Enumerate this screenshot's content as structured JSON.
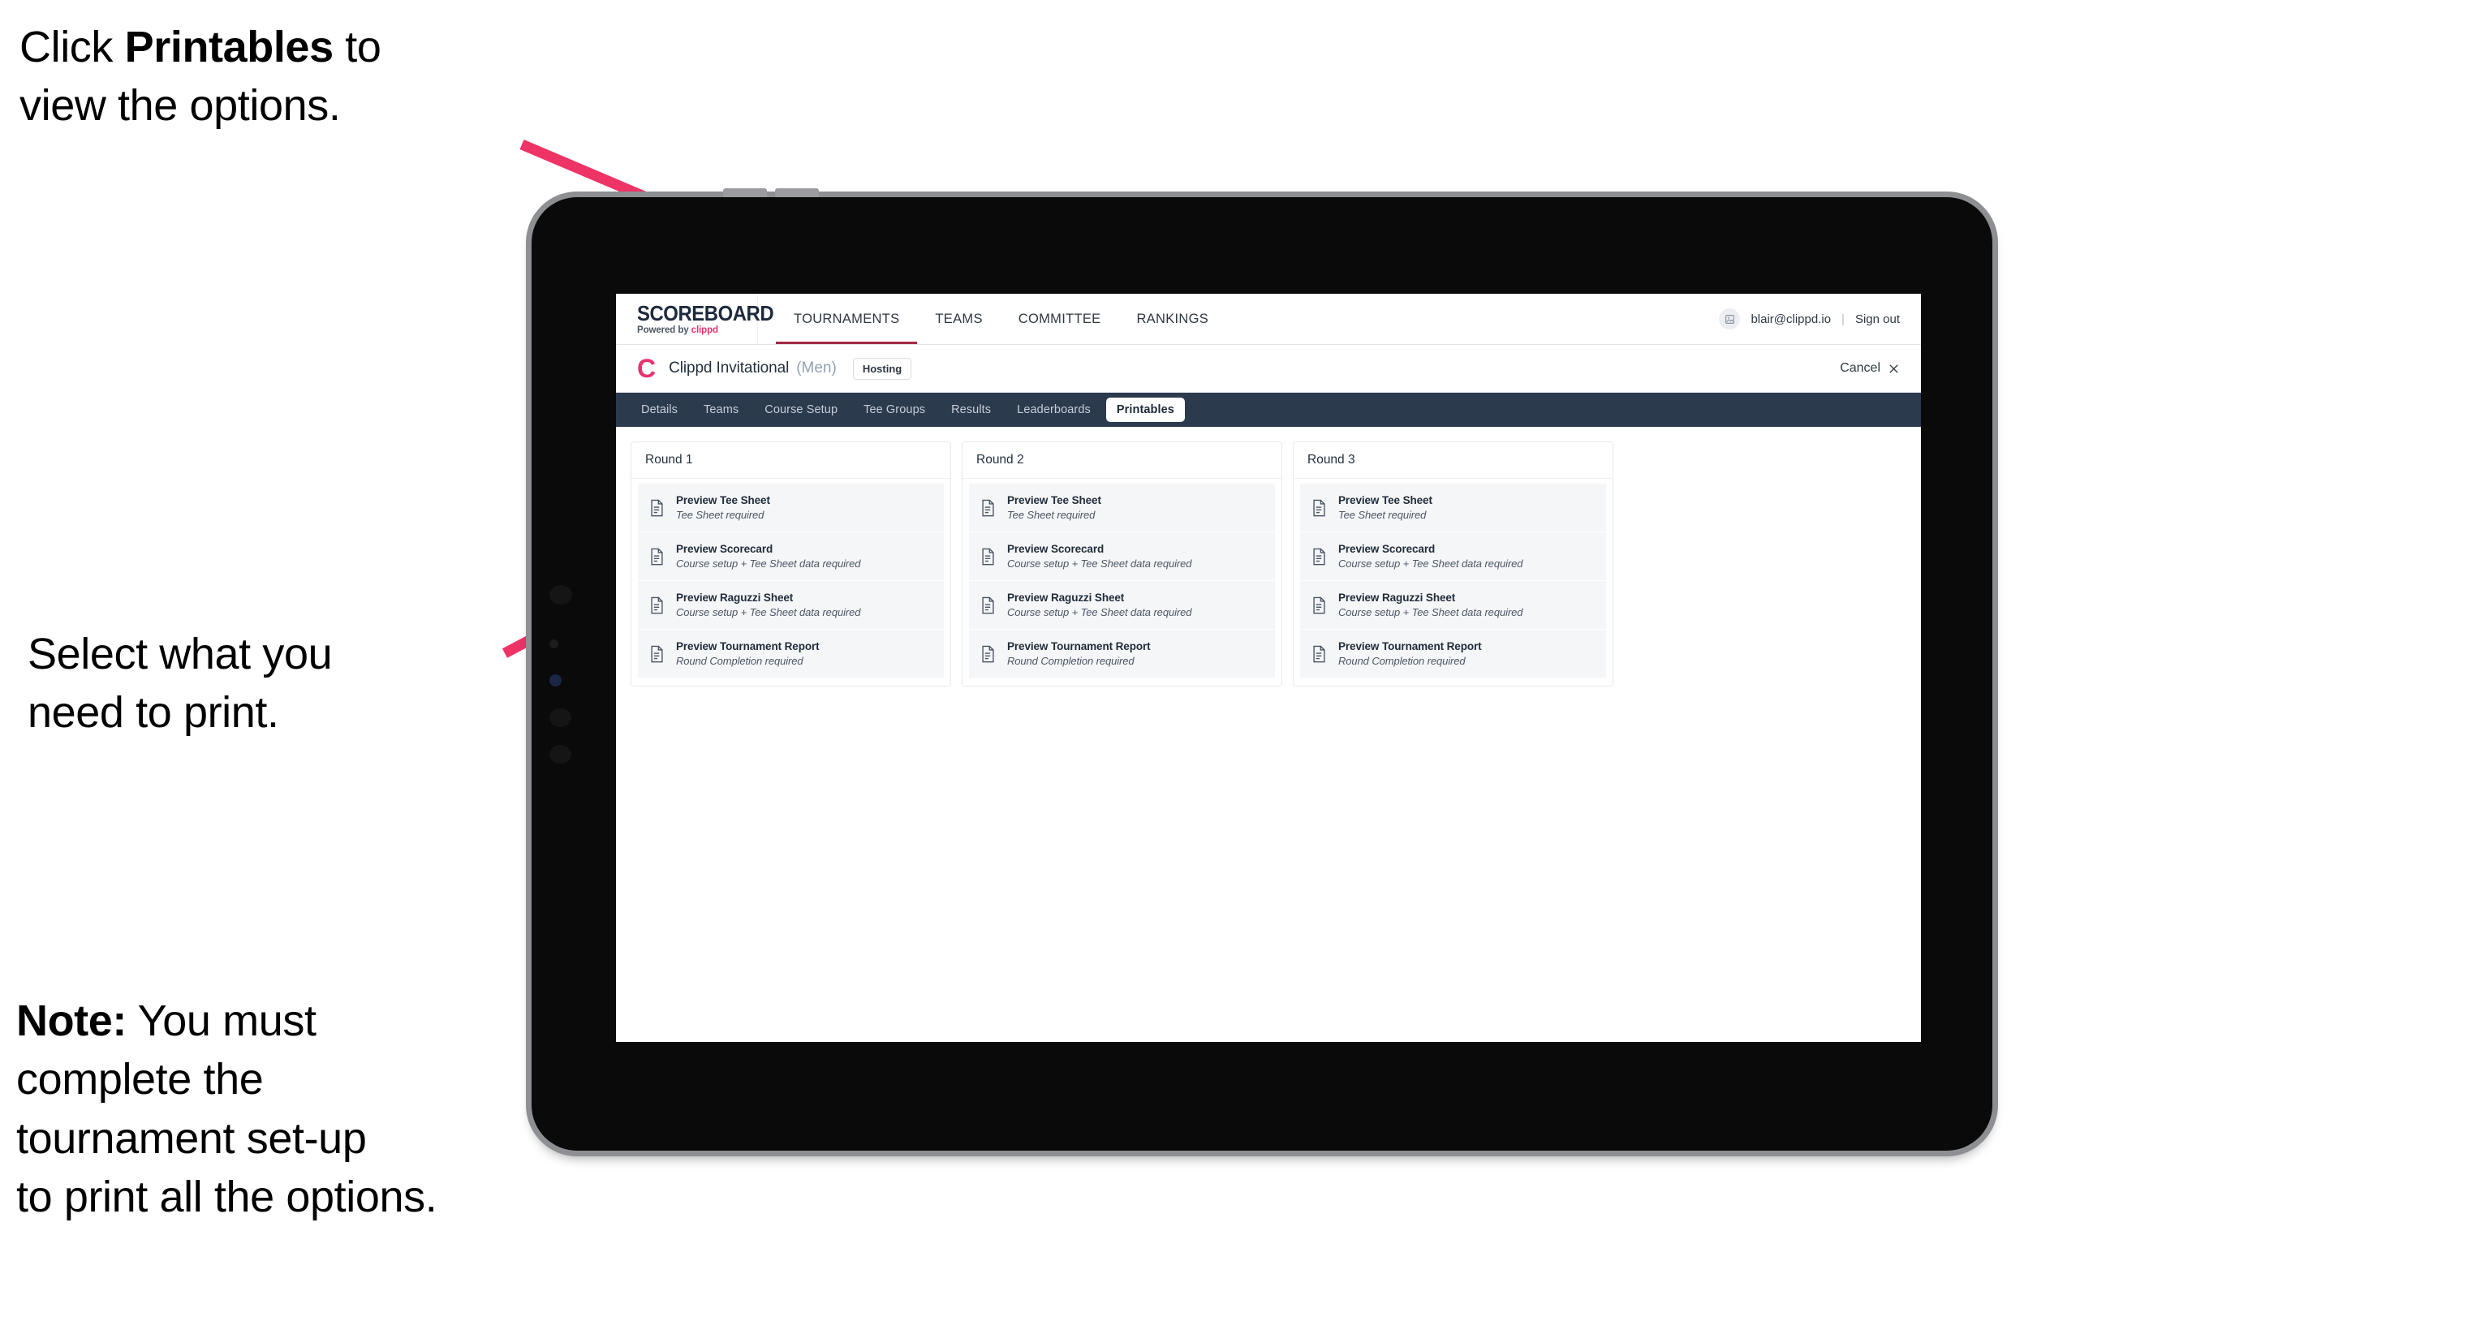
{
  "annotations": {
    "click_printables": {
      "prefix": "Click ",
      "bold": "Printables",
      "suffix": " to\nview the options."
    },
    "select_print": "Select what you\n need to print.",
    "note": {
      "bold": "Note:",
      "text": " You must\ncomplete the\ntournament set-up\nto print all the options."
    }
  },
  "app": {
    "logo": {
      "wordmark": "SCOREBOARD",
      "powered_prefix": "Powered by ",
      "powered_brand": "clippd"
    },
    "top_nav": [
      {
        "label": "TOURNAMENTS",
        "active": true
      },
      {
        "label": "TEAMS",
        "active": false
      },
      {
        "label": "COMMITTEE",
        "active": false
      },
      {
        "label": "RANKINGS",
        "active": false
      }
    ],
    "account": {
      "avatar_icon": "user-avatar-icon",
      "email": "blair@clippd.io",
      "separator": "|",
      "sign_out": "Sign out"
    },
    "tournament_bar": {
      "logo_mark": "C",
      "name": "Clippd Invitational",
      "gender": "(Men)",
      "status_badge": "Hosting",
      "cancel_label": "Cancel",
      "cancel_icon": "close-icon"
    },
    "tabs": [
      {
        "label": "Details",
        "active": false
      },
      {
        "label": "Teams",
        "active": false
      },
      {
        "label": "Course Setup",
        "active": false
      },
      {
        "label": "Tee Groups",
        "active": false
      },
      {
        "label": "Results",
        "active": false
      },
      {
        "label": "Leaderboards",
        "active": false
      },
      {
        "label": "Printables",
        "active": true
      }
    ],
    "rounds": [
      {
        "title": "Round 1",
        "items": [
          {
            "title": "Preview Tee Sheet",
            "subtitle": "Tee Sheet required"
          },
          {
            "title": "Preview Scorecard",
            "subtitle": "Course setup + Tee Sheet data required"
          },
          {
            "title": "Preview Raguzzi Sheet",
            "subtitle": "Course setup + Tee Sheet data required"
          },
          {
            "title": "Preview Tournament Report",
            "subtitle": "Round Completion required"
          }
        ]
      },
      {
        "title": "Round 2",
        "items": [
          {
            "title": "Preview Tee Sheet",
            "subtitle": "Tee Sheet required"
          },
          {
            "title": "Preview Scorecard",
            "subtitle": "Course setup + Tee Sheet data required"
          },
          {
            "title": "Preview Raguzzi Sheet",
            "subtitle": "Course setup + Tee Sheet data required"
          },
          {
            "title": "Preview Tournament Report",
            "subtitle": "Round Completion required"
          }
        ]
      },
      {
        "title": "Round 3",
        "items": [
          {
            "title": "Preview Tee Sheet",
            "subtitle": "Tee Sheet required"
          },
          {
            "title": "Preview Scorecard",
            "subtitle": "Course setup + Tee Sheet data required"
          },
          {
            "title": "Preview Raguzzi Sheet",
            "subtitle": "Course setup + Tee Sheet data required"
          },
          {
            "title": "Preview Tournament Report",
            "subtitle": "Round Completion required"
          }
        ]
      }
    ]
  },
  "colors": {
    "arrow": "#ee3366",
    "brand_pink": "#e8336d",
    "tabbar_navy": "#2c3a4e",
    "active_underline": "#a32a48",
    "device_bezel": "#0a0a0a",
    "device_frame": "#8d8f92"
  }
}
